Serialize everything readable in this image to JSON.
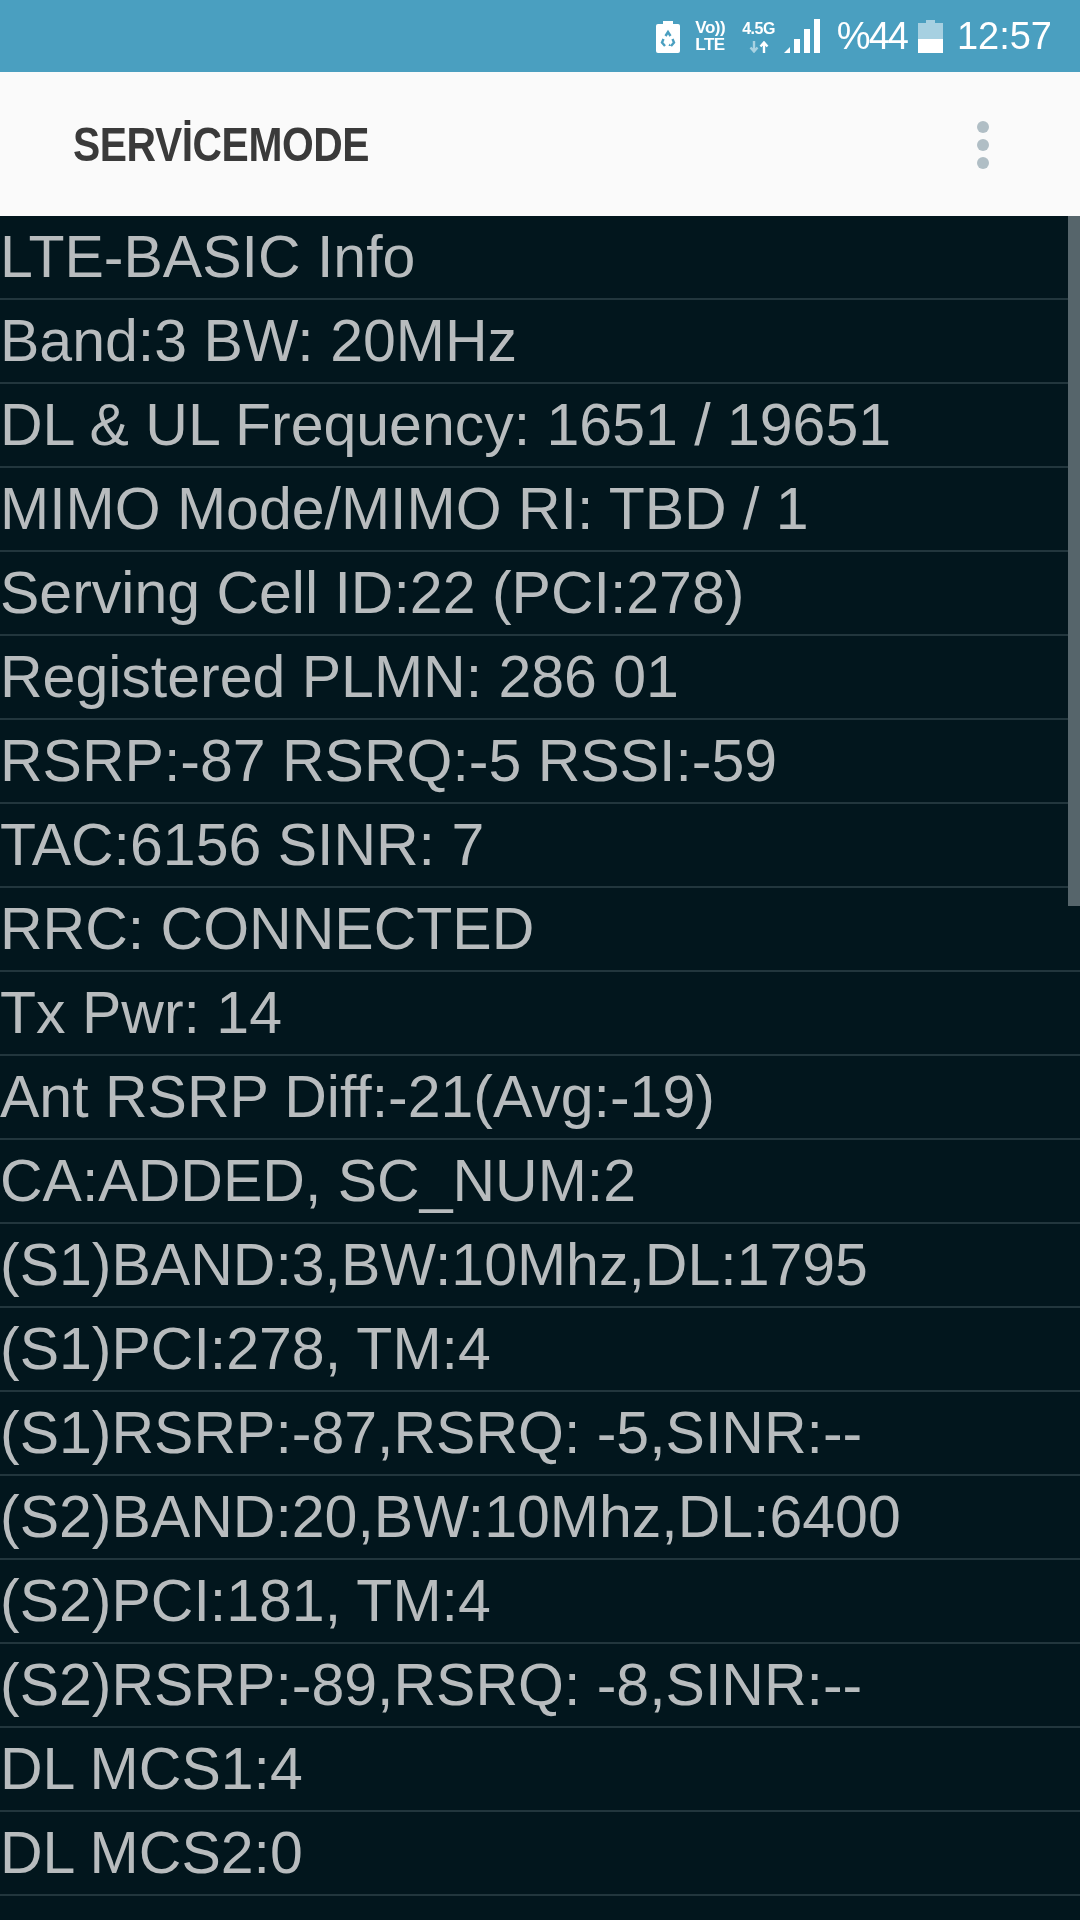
{
  "status_bar": {
    "volte_top": "Vo))",
    "volte_bottom": "LTE",
    "network": "4.5G",
    "battery": "%44",
    "time": "12:57"
  },
  "app_bar": {
    "title": "SERVİCEMODE"
  },
  "info_rows": [
    "LTE-BASIC Info",
    "Band:3 BW: 20MHz",
    "DL & UL Frequency: 1651 / 19651",
    "MIMO Mode/MIMO RI: TBD / 1",
    "Serving Cell ID:22 (PCI:278)",
    "Registered PLMN: 286 01",
    "RSRP:-87 RSRQ:-5 RSSI:-59",
    "TAC:6156 SINR: 7",
    "RRC: CONNECTED",
    "Tx Pwr: 14",
    "Ant RSRP Diff:-21(Avg:-19)",
    "CA:ADDED, SC_NUM:2",
    "(S1)BAND:3,BW:10Mhz,DL:1795",
    "(S1)PCI:278, TM:4",
    "(S1)RSRP:-87,RSRQ: -5,SINR:--",
    "(S2)BAND:20,BW:10Mhz,DL:6400",
    "(S2)PCI:181, TM:4",
    "(S2)RSRP:-89,RSRQ: -8,SINR:--",
    "DL MCS1:4",
    "DL MCS2:0"
  ]
}
